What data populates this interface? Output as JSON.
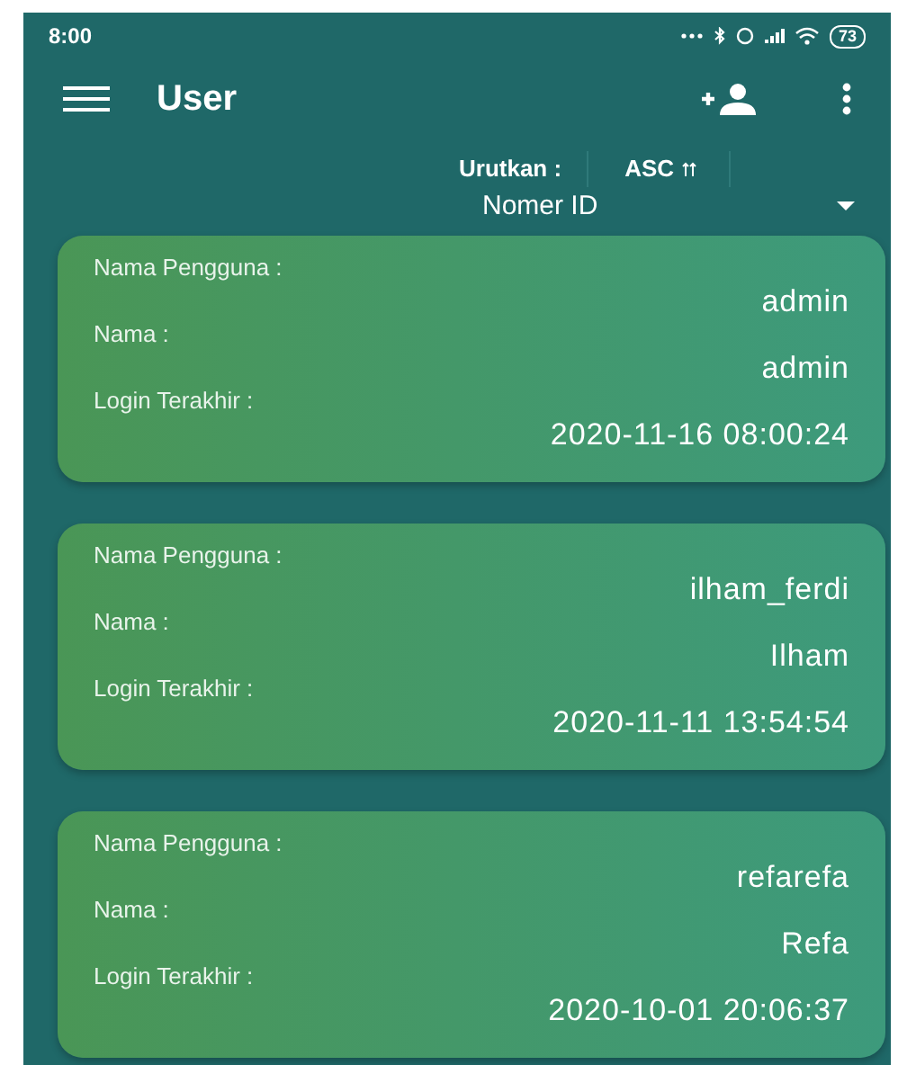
{
  "status_bar": {
    "time": "8:00",
    "battery": "73"
  },
  "toolbar": {
    "title": "User"
  },
  "sort": {
    "label": "Urutkan :",
    "order": "ASC",
    "field": "Nomer ID"
  },
  "users": [
    {
      "username_label": "Nama Pengguna :",
      "username": "admin",
      "name_label": "Nama :",
      "name": "admin",
      "login_label": "Login Terakhir :",
      "last_login": "2020-11-16 08:00:24"
    },
    {
      "username_label": "Nama Pengguna :",
      "username": "ilham_ferdi",
      "name_label": "Nama :",
      "name": "Ilham",
      "login_label": "Login Terakhir :",
      "last_login": "2020-11-11 13:54:54"
    },
    {
      "username_label": "Nama Pengguna :",
      "username": "refarefa",
      "name_label": "Nama :",
      "name": "Refa",
      "login_label": "Login Terakhir :",
      "last_login": "2020-10-01 20:06:37"
    }
  ]
}
